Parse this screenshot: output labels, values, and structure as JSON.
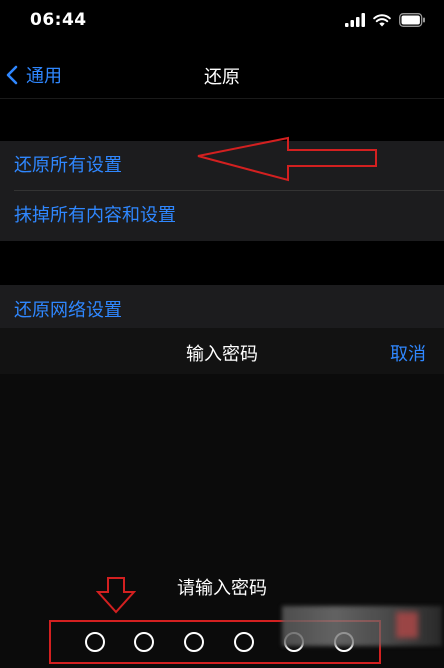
{
  "status_bar": {
    "time": "06:44",
    "icons": [
      "signal-icon",
      "wifi-icon",
      "battery-icon"
    ]
  },
  "nav": {
    "back_label": "通用",
    "title": "还原"
  },
  "group1": {
    "items": [
      {
        "label": "还原所有设置"
      },
      {
        "label": "抹掉所有内容和设置"
      }
    ]
  },
  "group2": {
    "items": [
      {
        "label": "还原网络设置"
      }
    ]
  },
  "passcode_sheet": {
    "title": "输入密码",
    "cancel_label": "取消",
    "prompt": "请输入密码",
    "dot_count": 6
  },
  "colors": {
    "accent": "#2f87ff",
    "annotation": "#d32020",
    "background": "#000000",
    "cell_background": "#1c1c1e"
  }
}
